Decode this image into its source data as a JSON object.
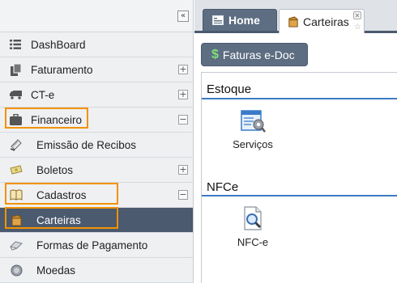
{
  "sidebar": {
    "collapse_label": "«",
    "items": [
      {
        "label": "DashBoard",
        "icon": "list-icon"
      },
      {
        "label": "Faturamento",
        "icon": "document-icon",
        "expander": "+"
      },
      {
        "label": "CT-e",
        "icon": "truck-icon",
        "expander": "+"
      },
      {
        "label": "Financeiro",
        "icon": "briefcase-icon",
        "expander": "−"
      },
      {
        "label": "Emissão de Recibos",
        "icon": "receipt-icon"
      },
      {
        "label": "Boletos",
        "icon": "money-icon",
        "expander": "+"
      },
      {
        "label": "Cadastros",
        "icon": "book-icon",
        "expander": "−"
      },
      {
        "label": "Carteiras",
        "icon": "wallet-icon"
      },
      {
        "label": "Formas de Pagamento",
        "icon": "payment-icon"
      },
      {
        "label": "Moedas",
        "icon": "coin-icon"
      }
    ]
  },
  "tabs": {
    "home_label": "Home",
    "carteiras_label": "Carteiras"
  },
  "toolbar": {
    "faturas_symbol": "$",
    "faturas_label": "Faturas e-Doc"
  },
  "sections": {
    "estoque_title": "Estoque",
    "servicos_label": "Serviços",
    "nfce_title": "NFCe",
    "nfce_label": "NFC-e"
  },
  "colors": {
    "accent": "#4b5a6e",
    "highlight": "#f39200",
    "section_line": "#3c7bc4"
  }
}
